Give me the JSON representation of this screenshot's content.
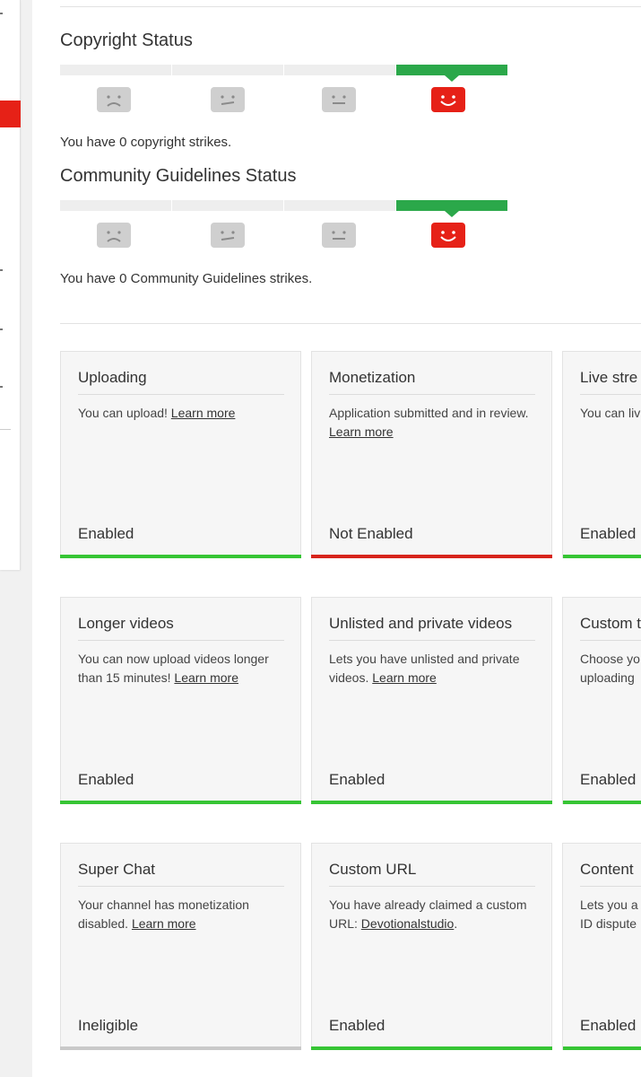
{
  "colors": {
    "accent_red": "#e62117",
    "enabled_green": "#36c534",
    "strike_green": "#2ba84a",
    "ineligible_grey": "#c9c9c9"
  },
  "copyright": {
    "title": "Copyright Status",
    "strikes_text": "You have 0 copyright strikes.",
    "level": 4,
    "faces": [
      "sad-face-icon",
      "neutral-face-icon",
      "neutral-face-icon",
      "happy-face-icon"
    ]
  },
  "community": {
    "title": "Community Guidelines Status",
    "strikes_text": "You have 0 Community Guidelines strikes.",
    "level": 4,
    "faces": [
      "sad-face-icon",
      "neutral-face-icon",
      "neutral-face-icon",
      "happy-face-icon"
    ]
  },
  "features": [
    {
      "title": "Uploading",
      "desc": "You can upload! ",
      "link": "Learn more",
      "status": "Enabled",
      "state": "enabled"
    },
    {
      "title": "Monetization",
      "desc": "Application submitted and in review. ",
      "link": "Learn more",
      "status": "Not Enabled",
      "state": "not-enabled"
    },
    {
      "title": "Live stre",
      "desc": "You can liv",
      "link": "",
      "status": "Enabled",
      "state": "enabled"
    },
    {
      "title": "Longer videos",
      "desc": "You can now upload videos longer than 15 minutes! ",
      "link": "Learn more",
      "status": "Enabled",
      "state": "enabled"
    },
    {
      "title": "Unlisted and private videos",
      "desc": "Lets you have unlisted and private videos. ",
      "link": "Learn more",
      "status": "Enabled",
      "state": "enabled"
    },
    {
      "title": "Custom t",
      "desc": "Choose yo uploading",
      "link": "",
      "status": "Enabled",
      "state": "enabled"
    },
    {
      "title": "Super Chat",
      "desc": "Your channel has monetization disabled. ",
      "link": "Learn more",
      "status": "Ineligible",
      "state": "ineligible"
    },
    {
      "title": "Custom URL",
      "desc": "You have already claimed a custom URL: ",
      "link": "Devotionalstudio",
      "desc_suffix": ".",
      "status": "Enabled",
      "state": "enabled"
    },
    {
      "title": "Content",
      "desc": "Lets you a ID dispute",
      "link": "",
      "status": "Enabled",
      "state": "enabled"
    }
  ]
}
